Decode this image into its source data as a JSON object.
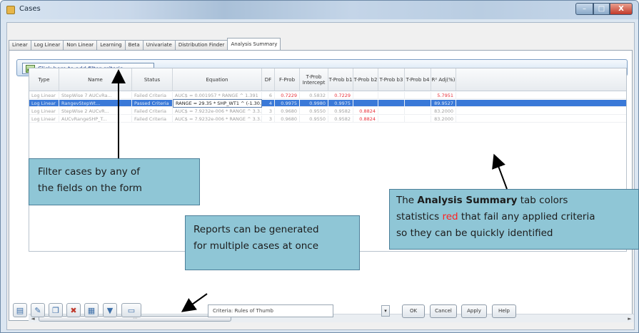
{
  "window": {
    "title": "Cases",
    "controls": {
      "minimize": "–",
      "maximize": "□",
      "close": "X"
    }
  },
  "tabs": [
    "Linear",
    "Log Linear",
    "Non Linear",
    "Learning",
    "Beta",
    "Univariate",
    "Distribution Finder",
    "Analysis Summary"
  ],
  "active_tab": "Analysis Summary",
  "filter_button": {
    "label": "Click here to add filter criteria"
  },
  "grid": {
    "columns": [
      "Type",
      "Name",
      "Status",
      "Equation",
      "DF",
      "F-Prob",
      "T-Prob Intercept",
      "T-Prob b1",
      "T-Prob b2",
      "T-Prob b3",
      "T-Prob b4",
      "R² Adj(%)"
    ],
    "rows": [
      {
        "selected": false,
        "cells": [
          "Log Linear",
          "StepWise 7 AUCvRa...",
          "Failed Criteria",
          "AUC$ = 0.001957 * RANGE ^ 1.391",
          "6",
          "0.7229",
          "0.5832",
          "0.7229",
          "",
          "",
          "",
          "5.7951"
        ],
        "red": [
          5,
          7,
          11
        ]
      },
      {
        "selected": true,
        "cells": [
          "Log Linear",
          "RangevStepWt...",
          "Passed Criteria",
          "RANGE = 29.35 * SHP_WT1 ^ (-1.30...",
          "4",
          "0.9975",
          "0.9980",
          "0.9975",
          "",
          "",
          "",
          "89.9527"
        ],
        "red": []
      },
      {
        "selected": false,
        "cells": [
          "Log Linear",
          "StepWise 2 AUCvR...",
          "Failed Criteria",
          "AUC$ = 7.9232e-006 * RANGE ^ 3.3...",
          "3",
          "0.9680",
          "0.9550",
          "0.9582",
          "0.8824",
          "",
          "",
          "83.2000"
        ],
        "red": [
          8
        ]
      },
      {
        "selected": false,
        "cells": [
          "Log Linear",
          "AUCvRangeSHP_T...",
          "Failed Criteria",
          "AUC$ = 7.9232e-006 * RANGE ^ 3.3...",
          "3",
          "0.9680",
          "0.9550",
          "0.9582",
          "0.8824",
          "",
          "",
          "83.2000"
        ],
        "red": [
          8
        ]
      }
    ]
  },
  "scrollbar": {
    "left_arrow": "◄",
    "right_arrow": "►",
    "thumb_grip": "⋯"
  },
  "toolbar": {
    "icons": [
      "new-case-icon",
      "edit-case-icon",
      "copy-case-icon",
      "delete-case-icon",
      "calculator-icon",
      "move-down-icon",
      "report-icon"
    ]
  },
  "criteria": {
    "value": "Criteria: Rules of Thumb",
    "drop_arrow": "▾"
  },
  "buttons": {
    "ok": "OK",
    "cancel": "Cancel",
    "apply": "Apply",
    "help": "Help"
  },
  "callouts": {
    "filter": {
      "line1": "Filter cases by any of",
      "line2": "the fields on the form"
    },
    "reports": {
      "line1": "Reports can be generated",
      "line2": "for multiple cases at once"
    },
    "summary": {
      "pre": "The ",
      "bold": "Analysis Summary",
      "post": " tab colors",
      "line2_pre": "statistics ",
      "line2_red": "red",
      "line2_post": " that fail any applied criteria",
      "line3": "so they can be quickly identified"
    }
  },
  "colors": {
    "red_stat": "#e8303a",
    "callout_bg": "#8fc6d6",
    "selection": "#3a79d8"
  }
}
